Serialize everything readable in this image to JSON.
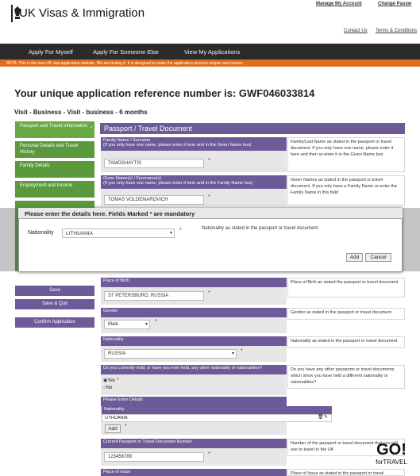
{
  "header": {
    "brand": "UK Visas & Immigration",
    "links": [
      "Manage My Account",
      "Change Passw",
      "Contact Us",
      "Terms & Conditions"
    ]
  },
  "nav": {
    "items": [
      "Apply For Myself",
      "Apply For Someone Else",
      "View My Applications"
    ]
  },
  "beta": "BETA: This is the new UK visa application website. We are testing it. It is designed to make the application process simpler and clearer.",
  "reference": "Your unique application reference number is: GWF046033814",
  "application_type": "Visit - Business - Visit - business - 6 months",
  "sidebar": {
    "items": [
      "Passport and Travel Information",
      "Personal Details and Travel History",
      "Family Details",
      "Employment and Income"
    ],
    "buttons": [
      "Save",
      "Save & Quit",
      "Confirm Application"
    ]
  },
  "section": "Passport / Travel Document",
  "fields": {
    "family_name": {
      "label": "Family Name / Surname",
      "sublabel": "(If you only have one name, please enter it here and in the Given Name box)",
      "value": "TAMOSHAYTIS",
      "help": "Family/Last Name as stated in the passport or travel document. If you only have one name, please enter it here and then re-enter it in the Given Name box"
    },
    "given_names": {
      "label": "Given Name(s) / Forename(s)",
      "sublabel": "(If you only have one name, please enter it here and in the Family Name box)",
      "value": "TOMAS VOLDEMAROVICH",
      "help": "Given Names as stated in the passport or travel document. If you only have a Family Name re-enter the Family Name in this field"
    },
    "place_of_birth": {
      "label": "Place of Birth",
      "value": "ST PETERSBURG, RUSSIA",
      "help": "Place of Birth as stated the passport or travel document"
    },
    "gender": {
      "label": "Gender",
      "value": "Male",
      "help": "Gender as stated in the passport or travel document"
    },
    "nationality": {
      "label": "Nationality",
      "value": "RUSSIA",
      "help": "Nationality as stated in the passport or travel document"
    },
    "other_nationality": {
      "label": "Do you currently hold, or have you ever held, any other nationality or nationalities?",
      "yes": "Yes",
      "no": "No",
      "help": "Do you have any other passports or travel documents which show you have held a different nationality or nationalities?"
    },
    "please_enter": "Please Enter Details",
    "nat_table": {
      "header": "Nationality",
      "value": "LITHUANIA",
      "add": "Add"
    },
    "passport_number": {
      "label": "Current Passport or Travel Document Number",
      "value": "123456789",
      "help": "Number of the passport or travel document that you will use to travel to the UK"
    },
    "place_of_issue": {
      "label": "Place of Issue",
      "help": "Place of Issue as stated in the passport or travel"
    }
  },
  "modal": {
    "title_part1": "Please enter the details here. Fields Marked",
    "star": "*",
    "title_part2": "are mandatory",
    "label": "Nationality",
    "value": "LITHUANIA",
    "help": "Nationality as stated in the passport or travel document",
    "add": "Add",
    "cancel": "Cancel"
  },
  "watermark": {
    "line1": "GO!",
    "line2": "forTRAVEL"
  },
  "colors": {
    "purple": "#6c5a99",
    "green": "#5b9a3c",
    "orange": "#e06d1b",
    "nav": "#2b2b2b"
  }
}
